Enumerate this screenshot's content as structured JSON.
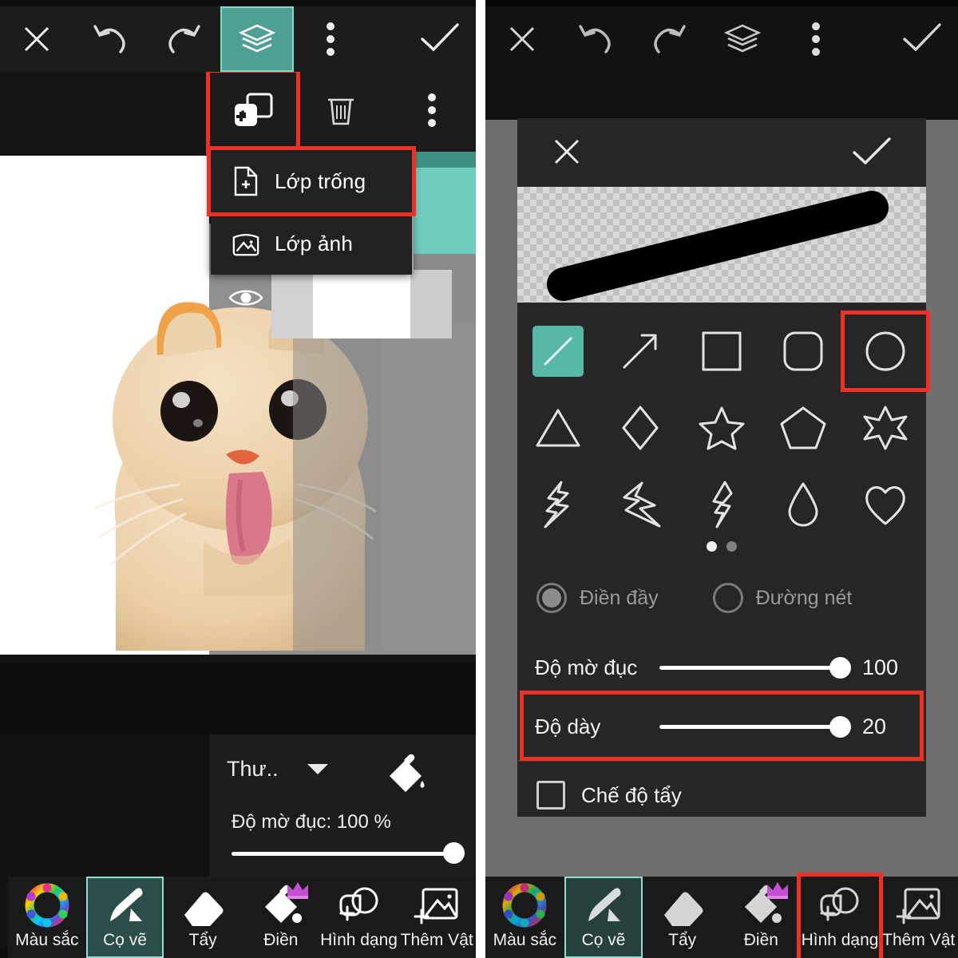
{
  "meta": {
    "app": "ibis Paint X",
    "language": "vi",
    "accent_teal": "#4da093",
    "accent_teal_light": "#6fcdbe",
    "highlight_red": "#ee3124",
    "panel_bg": "#1c1c1c",
    "sheet_bg": "#262626"
  },
  "left_panel": {
    "appbar": {
      "close_icon": "close-x-icon",
      "undo_icon": "undo-arrow-icon",
      "redo_icon": "redo-arrow-icon",
      "layers_icon": "layers-stack-icon",
      "overflow_icon": "three-dots-vertical-icon",
      "confirm_icon": "checkmark-icon"
    },
    "layer_toolbar": {
      "add_layer_icon": "add-layer-plus-icon",
      "delete_layer_icon": "trash-bin-icon",
      "more_icon": "three-dots-vertical-icon"
    },
    "dropdown": {
      "items": [
        {
          "label": "Lớp trống",
          "icon": "document-plus-icon",
          "highlighted": true
        },
        {
          "label": "Lớp ảnh",
          "icon": "image-frame-icon",
          "highlighted": false
        }
      ]
    },
    "layer_row": {
      "visibility_icon": "eye-visible-icon"
    },
    "blend_options": {
      "blend_mode_value": "Thư..",
      "dropdown_icon": "caret-down-icon",
      "bucket_icon": "paint-bucket-icon",
      "opacity_label": "Độ mờ đục: 100 %",
      "opacity_value": 100
    },
    "toolbar": {
      "items": [
        {
          "label": "Màu sắc",
          "icon": "color-wheel-icon",
          "active": false,
          "badge": null,
          "highlighted": false
        },
        {
          "label": "Cọ vẽ",
          "icon": "paintbrush-icon",
          "active": true,
          "badge": null,
          "highlighted": false
        },
        {
          "label": "Tẩy",
          "icon": "eraser-icon",
          "active": false,
          "badge": null,
          "highlighted": false
        },
        {
          "label": "Điền",
          "icon": "paint-bucket-icon",
          "active": false,
          "badge": "crown-icon",
          "highlighted": false
        },
        {
          "label": "Hình dạng",
          "icon": "add-shape-icon",
          "active": false,
          "badge": null,
          "highlighted": false
        },
        {
          "label": "Thêm Vật",
          "icon": "add-image-icon",
          "active": false,
          "badge": null,
          "highlighted": false
        }
      ]
    }
  },
  "right_panel": {
    "appbar": {
      "close_icon": "close-x-icon",
      "undo_icon": "undo-arrow-icon",
      "redo_icon": "redo-arrow-icon",
      "layers_icon": "layers-stack-icon",
      "overflow_icon": "three-dots-vertical-icon",
      "confirm_icon": "checkmark-icon"
    },
    "shape_sheet": {
      "cancel_icon": "close-x-icon",
      "confirm_icon": "checkmark-icon",
      "preview": {
        "stroke_color": "#000000",
        "background": "transparency-checkerboard"
      },
      "shapes": [
        {
          "name": "line",
          "icon": "diagonal-line-icon",
          "selected": true,
          "highlighted": false
        },
        {
          "name": "arrow",
          "icon": "arrow-diagonal-icon",
          "selected": false,
          "highlighted": false
        },
        {
          "name": "square",
          "icon": "square-outline-icon",
          "selected": false,
          "highlighted": false
        },
        {
          "name": "rounded-square",
          "icon": "rounded-square-icon",
          "selected": false,
          "highlighted": false
        },
        {
          "name": "circle",
          "icon": "circle-outline-icon",
          "selected": false,
          "highlighted": true
        },
        {
          "name": "triangle",
          "icon": "triangle-outline-icon",
          "selected": false,
          "highlighted": false
        },
        {
          "name": "diamond",
          "icon": "diamond-outline-icon",
          "selected": false,
          "highlighted": false
        },
        {
          "name": "star-5",
          "icon": "star-five-point-icon",
          "selected": false,
          "highlighted": false
        },
        {
          "name": "pentagon",
          "icon": "pentagon-outline-icon",
          "selected": false,
          "highlighted": false
        },
        {
          "name": "star-6",
          "icon": "star-six-point-icon",
          "selected": false,
          "highlighted": false
        },
        {
          "name": "lightning-1",
          "icon": "lightning-bolt-icon",
          "selected": false,
          "highlighted": false
        },
        {
          "name": "lightning-2",
          "icon": "lightning-bolt-alt-icon",
          "selected": false,
          "highlighted": false
        },
        {
          "name": "lightning-3",
          "icon": "lightning-bolt-thin-icon",
          "selected": false,
          "highlighted": false
        },
        {
          "name": "droplet",
          "icon": "water-drop-icon",
          "selected": false,
          "highlighted": false
        },
        {
          "name": "heart",
          "icon": "heart-outline-icon",
          "selected": false,
          "highlighted": false
        }
      ],
      "pager": {
        "pages": 2,
        "current": 1
      },
      "fill_modes": [
        {
          "label": "Điền đầy",
          "checked": true
        },
        {
          "label": "Đường nét",
          "checked": false
        }
      ],
      "sliders": [
        {
          "label": "Độ mờ đục",
          "value": 100,
          "percent": 100,
          "highlighted": false
        },
        {
          "label": "Độ dày",
          "value": 20,
          "percent": 100,
          "highlighted": true
        }
      ],
      "eraser_mode": {
        "label": "Chế độ tẩy",
        "checked": false
      }
    },
    "toolbar": {
      "items": [
        {
          "label": "Màu sắc",
          "icon": "color-wheel-icon",
          "active": false,
          "badge": null,
          "highlighted": false
        },
        {
          "label": "Cọ vẽ",
          "icon": "paintbrush-icon",
          "active": true,
          "badge": null,
          "highlighted": false
        },
        {
          "label": "Tẩy",
          "icon": "eraser-icon",
          "active": false,
          "badge": null,
          "highlighted": false
        },
        {
          "label": "Điền",
          "icon": "paint-bucket-icon",
          "active": false,
          "badge": "crown-icon",
          "highlighted": false
        },
        {
          "label": "Hình dạng",
          "icon": "add-shape-icon",
          "active": false,
          "badge": null,
          "highlighted": true
        },
        {
          "label": "Thêm Vật",
          "icon": "add-image-icon",
          "active": false,
          "badge": null,
          "highlighted": false
        }
      ]
    }
  }
}
